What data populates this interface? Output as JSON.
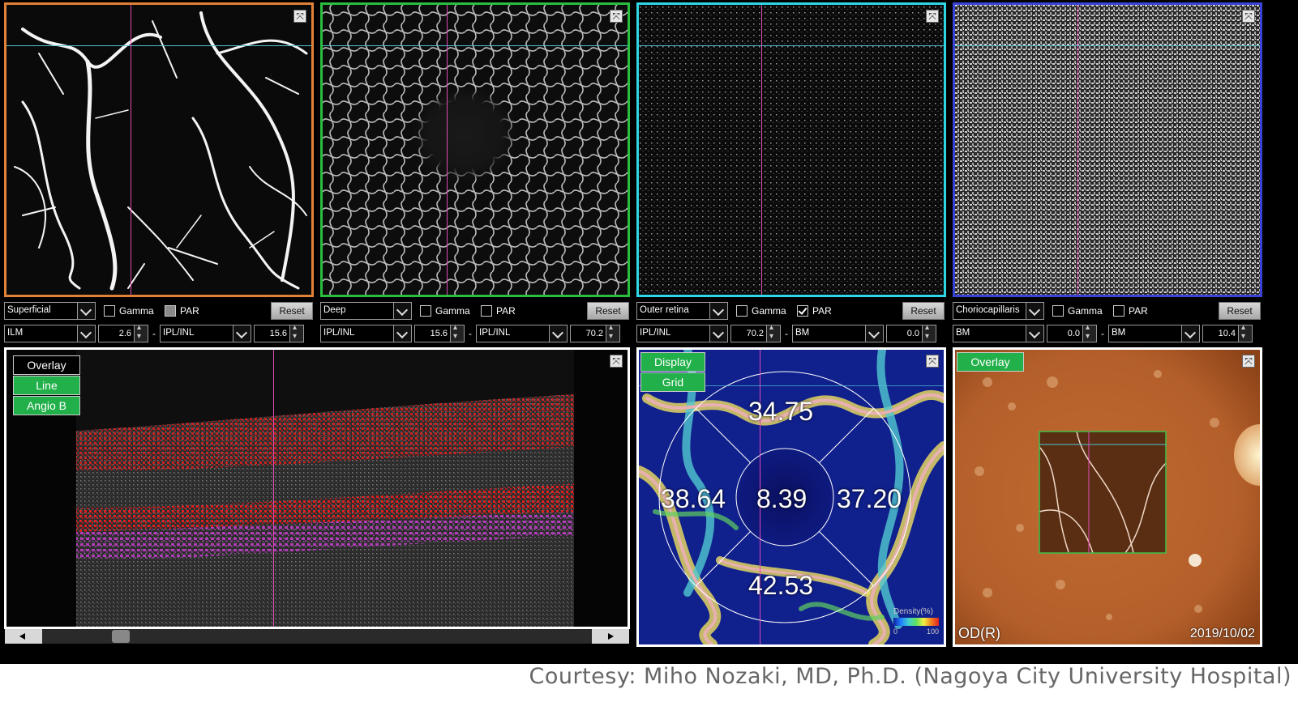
{
  "angio_panels": [
    {
      "id": "superficial",
      "border": "#e0813a",
      "layer": "Superficial",
      "gamma_label": "Gamma",
      "par_label": "PAR",
      "par_state": "filled",
      "reset_label": "Reset",
      "top_ref": "ILM",
      "top_offset": "2.6",
      "bottom_ref": "IPL/INL",
      "bottom_offset": "15.6"
    },
    {
      "id": "deep",
      "border": "#2bbd3f",
      "layer": "Deep",
      "gamma_label": "Gamma",
      "par_label": "PAR",
      "par_state": "unchecked",
      "reset_label": "Reset",
      "top_ref": "IPL/INL",
      "top_offset": "15.6",
      "bottom_ref": "IPL/INL",
      "bottom_offset": "70.2"
    },
    {
      "id": "outer",
      "border": "#2fd7e6",
      "layer": "Outer retina",
      "gamma_label": "Gamma",
      "par_label": "PAR",
      "par_state": "checked",
      "reset_label": "Reset",
      "top_ref": "IPL/INL",
      "top_offset": "70.2",
      "bottom_ref": "BM",
      "bottom_offset": "0.0"
    },
    {
      "id": "chorio",
      "border": "#3a43d9",
      "layer": "Choriocapillaris",
      "gamma_label": "Gamma",
      "par_label": "PAR",
      "par_state": "unchecked",
      "reset_label": "Reset",
      "top_ref": "BM",
      "top_offset": "0.0",
      "bottom_ref": "BM",
      "bottom_offset": "10.4"
    }
  ],
  "bscan": {
    "overlay_label": "Overlay",
    "line_label": "Line",
    "angio_b_label": "Angio B"
  },
  "density_map": {
    "display_label": "Display",
    "grid_label": "Grid",
    "values": {
      "superior": "34.75",
      "nasal_left": "38.64",
      "center": "8.39",
      "temporal_right": "37.20",
      "inferior": "42.53"
    },
    "legend_title": "Density(%)",
    "legend_min": "0",
    "legend_max": "100"
  },
  "fundus": {
    "overlay_label": "Overlay",
    "eye": "OD(R)",
    "date": "2019/10/02"
  },
  "dash": "-",
  "footer": "Courtesy: Miho Nozaki, MD, Ph.D. (Nagoya City University Hospital)",
  "colors": {
    "accent_green": "#22b04a",
    "vessel_white": "#ffffff",
    "retina_red": "#e02020",
    "choroid_magenta": "#c03cc8",
    "fundus_orange": "#b9642d"
  }
}
